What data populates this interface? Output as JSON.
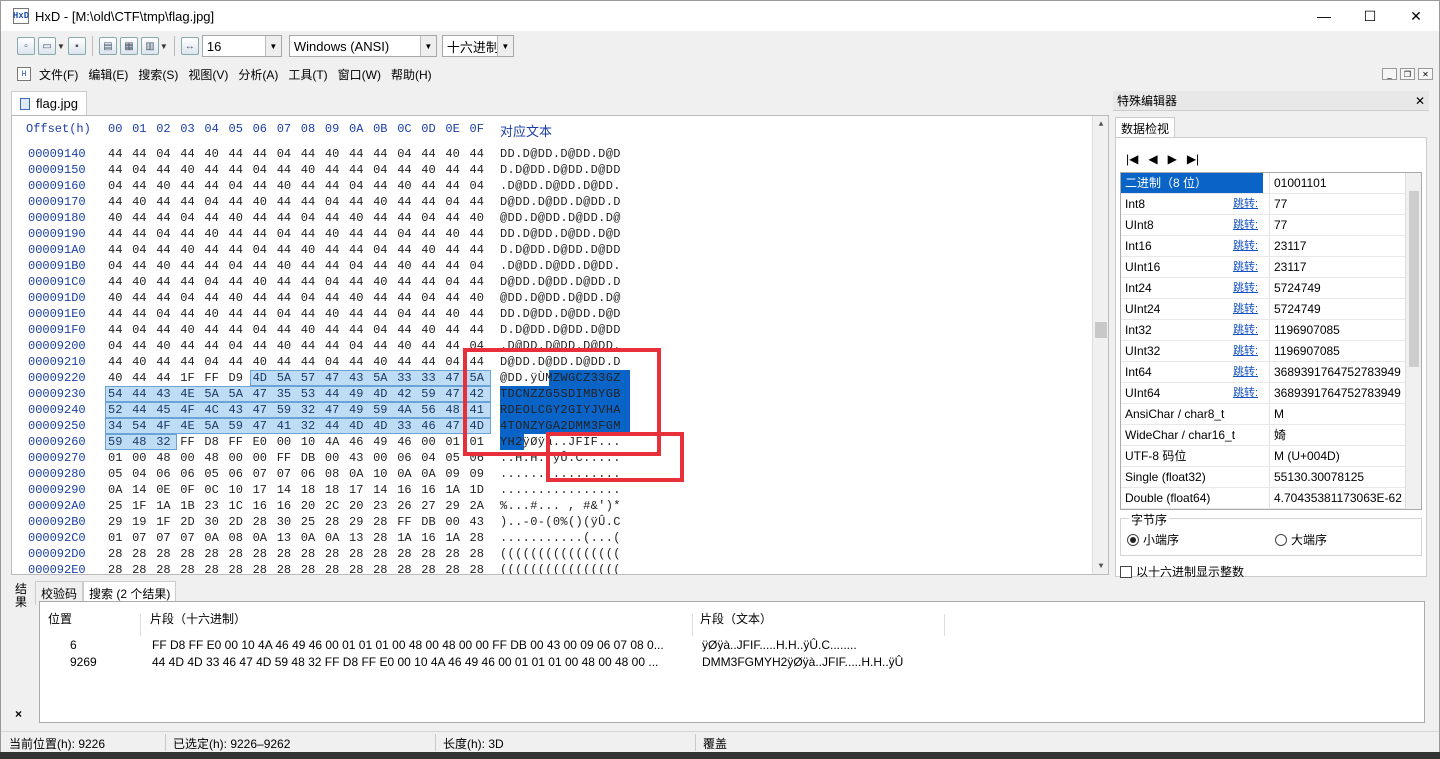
{
  "window": {
    "title": "HxD - [M:\\old\\CTF\\tmp\\flag.jpg]",
    "app_icon": "HxD",
    "minimize": "—",
    "maximize": "☐",
    "close": "✕"
  },
  "toolbar": {
    "bytes_per_row": "16",
    "encoding": "Windows (ANSI)",
    "offset_base": "十六进制"
  },
  "menu": {
    "items": [
      "文件(F)",
      "编辑(E)",
      "搜索(S)",
      "视图(V)",
      "分析(A)",
      "工具(T)",
      "窗口(W)",
      "帮助(H)"
    ]
  },
  "file_tab": "flag.jpg",
  "hex": {
    "offset_header": "Offset(h)",
    "columns": [
      "00",
      "01",
      "02",
      "03",
      "04",
      "05",
      "06",
      "07",
      "08",
      "09",
      "0A",
      "0B",
      "0C",
      "0D",
      "0E",
      "0F"
    ],
    "text_header": "对应文本",
    "rows": [
      {
        "addr": "00009140",
        "bytes": [
          "44",
          "44",
          "04",
          "44",
          "40",
          "44",
          "44",
          "04",
          "44",
          "40",
          "44",
          "44",
          "04",
          "44",
          "40",
          "44"
        ],
        "text": "DD.D@DD.D@DD.D@D"
      },
      {
        "addr": "00009150",
        "bytes": [
          "44",
          "04",
          "44",
          "40",
          "44",
          "44",
          "04",
          "44",
          "40",
          "44",
          "44",
          "04",
          "44",
          "40",
          "44",
          "44"
        ],
        "text": "D.D@DD.D@DD.D@DD"
      },
      {
        "addr": "00009160",
        "bytes": [
          "04",
          "44",
          "40",
          "44",
          "44",
          "04",
          "44",
          "40",
          "44",
          "44",
          "04",
          "44",
          "40",
          "44",
          "44",
          "04"
        ],
        "text": ".D@DD.D@DD.D@DD."
      },
      {
        "addr": "00009170",
        "bytes": [
          "44",
          "40",
          "44",
          "44",
          "04",
          "44",
          "40",
          "44",
          "44",
          "04",
          "44",
          "40",
          "44",
          "44",
          "04",
          "44"
        ],
        "text": "D@DD.D@DD.D@DD.D"
      },
      {
        "addr": "00009180",
        "bytes": [
          "40",
          "44",
          "44",
          "04",
          "44",
          "40",
          "44",
          "44",
          "04",
          "44",
          "40",
          "44",
          "44",
          "04",
          "44",
          "40"
        ],
        "text": "@DD.D@DD.D@DD.D@"
      },
      {
        "addr": "00009190",
        "bytes": [
          "44",
          "44",
          "04",
          "44",
          "40",
          "44",
          "44",
          "04",
          "44",
          "40",
          "44",
          "44",
          "04",
          "44",
          "40",
          "44"
        ],
        "text": "DD.D@DD.D@DD.D@D"
      },
      {
        "addr": "000091A0",
        "bytes": [
          "44",
          "04",
          "44",
          "40",
          "44",
          "44",
          "04",
          "44",
          "40",
          "44",
          "44",
          "04",
          "44",
          "40",
          "44",
          "44"
        ],
        "text": "D.D@DD.D@DD.D@DD"
      },
      {
        "addr": "000091B0",
        "bytes": [
          "04",
          "44",
          "40",
          "44",
          "44",
          "04",
          "44",
          "40",
          "44",
          "44",
          "04",
          "44",
          "40",
          "44",
          "44",
          "04"
        ],
        "text": ".D@DD.D@DD.D@DD."
      },
      {
        "addr": "000091C0",
        "bytes": [
          "44",
          "40",
          "44",
          "44",
          "04",
          "44",
          "40",
          "44",
          "44",
          "04",
          "44",
          "40",
          "44",
          "44",
          "04",
          "44"
        ],
        "text": "D@DD.D@DD.D@DD.D"
      },
      {
        "addr": "000091D0",
        "bytes": [
          "40",
          "44",
          "44",
          "04",
          "44",
          "40",
          "44",
          "44",
          "04",
          "44",
          "40",
          "44",
          "44",
          "04",
          "44",
          "40"
        ],
        "text": "@DD.D@DD.D@DD.D@"
      },
      {
        "addr": "000091E0",
        "bytes": [
          "44",
          "44",
          "04",
          "44",
          "40",
          "44",
          "44",
          "04",
          "44",
          "40",
          "44",
          "44",
          "04",
          "44",
          "40",
          "44"
        ],
        "text": "DD.D@DD.D@DD.D@D"
      },
      {
        "addr": "000091F0",
        "bytes": [
          "44",
          "04",
          "44",
          "40",
          "44",
          "44",
          "04",
          "44",
          "40",
          "44",
          "44",
          "04",
          "44",
          "40",
          "44",
          "44"
        ],
        "text": "D.D@DD.D@DD.D@DD"
      },
      {
        "addr": "00009200",
        "bytes": [
          "04",
          "44",
          "40",
          "44",
          "44",
          "04",
          "44",
          "40",
          "44",
          "44",
          "04",
          "44",
          "40",
          "44",
          "44",
          "04"
        ],
        "text": ".D@DD.D@DD.D@DD."
      },
      {
        "addr": "00009210",
        "bytes": [
          "44",
          "40",
          "44",
          "44",
          "04",
          "44",
          "40",
          "44",
          "44",
          "04",
          "44",
          "40",
          "44",
          "44",
          "04",
          "44"
        ],
        "text": "D@DD.D@DD.D@DD.D"
      },
      {
        "addr": "00009220",
        "bytes": [
          "40",
          "44",
          "44",
          "1F",
          "FF",
          "D9",
          "4D",
          "5A",
          "57",
          "47",
          "43",
          "5A",
          "33",
          "33",
          "47",
          "5A"
        ],
        "text": "@DD.ÿÙMZWGCZ33GZ"
      },
      {
        "addr": "00009230",
        "bytes": [
          "54",
          "44",
          "43",
          "4E",
          "5A",
          "5A",
          "47",
          "35",
          "53",
          "44",
          "49",
          "4D",
          "42",
          "59",
          "47",
          "42"
        ],
        "text": "TDCNZZG5SDIMBYGB"
      },
      {
        "addr": "00009240",
        "bytes": [
          "52",
          "44",
          "45",
          "4F",
          "4C",
          "43",
          "47",
          "59",
          "32",
          "47",
          "49",
          "59",
          "4A",
          "56",
          "48",
          "41"
        ],
        "text": "RDEOLCGY2GIYJVHA"
      },
      {
        "addr": "00009250",
        "bytes": [
          "34",
          "54",
          "4F",
          "4E",
          "5A",
          "59",
          "47",
          "41",
          "32",
          "44",
          "4D",
          "4D",
          "33",
          "46",
          "47",
          "4D"
        ],
        "text": "4TONZYGA2DMM3FGM"
      },
      {
        "addr": "00009260",
        "bytes": [
          "59",
          "48",
          "32",
          "FF",
          "D8",
          "FF",
          "E0",
          "00",
          "10",
          "4A",
          "46",
          "49",
          "46",
          "00",
          "01",
          "01"
        ],
        "text": "YH2ÿØÿà..JFIF..."
      },
      {
        "addr": "00009270",
        "bytes": [
          "01",
          "00",
          "48",
          "00",
          "48",
          "00",
          "00",
          "FF",
          "DB",
          "00",
          "43",
          "00",
          "06",
          "04",
          "05",
          "06"
        ],
        "text": "..H.H..ÿÛ.C....."
      },
      {
        "addr": "00009280",
        "bytes": [
          "05",
          "04",
          "06",
          "06",
          "05",
          "06",
          "07",
          "07",
          "06",
          "08",
          "0A",
          "10",
          "0A",
          "0A",
          "09",
          "09"
        ],
        "text": "................"
      },
      {
        "addr": "00009290",
        "bytes": [
          "0A",
          "14",
          "0E",
          "0F",
          "0C",
          "10",
          "17",
          "14",
          "18",
          "18",
          "17",
          "14",
          "16",
          "16",
          "1A",
          "1D"
        ],
        "text": "................"
      },
      {
        "addr": "000092A0",
        "bytes": [
          "25",
          "1F",
          "1A",
          "1B",
          "23",
          "1C",
          "16",
          "16",
          "20",
          "2C",
          "20",
          "23",
          "26",
          "27",
          "29",
          "2A"
        ],
        "text": "%...#... , #&')*"
      },
      {
        "addr": "000092B0",
        "bytes": [
          "29",
          "19",
          "1F",
          "2D",
          "30",
          "2D",
          "28",
          "30",
          "25",
          "28",
          "29",
          "28",
          "FF",
          "DB",
          "00",
          "43"
        ],
        "text": ")..-0-(0%()(ÿÛ.C"
      },
      {
        "addr": "000092C0",
        "bytes": [
          "01",
          "07",
          "07",
          "07",
          "0A",
          "08",
          "0A",
          "13",
          "0A",
          "0A",
          "13",
          "28",
          "1A",
          "16",
          "1A",
          "28"
        ],
        "text": "...........(...("
      },
      {
        "addr": "000092D0",
        "bytes": [
          "28",
          "28",
          "28",
          "28",
          "28",
          "28",
          "28",
          "28",
          "28",
          "28",
          "28",
          "28",
          "28",
          "28",
          "28",
          "28"
        ],
        "text": "(((((((((((((((("
      },
      {
        "addr": "000092E0",
        "bytes": [
          "28",
          "28",
          "28",
          "28",
          "28",
          "28",
          "28",
          "28",
          "28",
          "28",
          "28",
          "28",
          "28",
          "28",
          "28",
          "28"
        ],
        "text": "(((((((((((((((("
      }
    ]
  },
  "inspector": {
    "panel_title": "特殊编辑器",
    "tab": "数据检视",
    "nav": [
      "|◀",
      "◀",
      "▶",
      "▶|"
    ],
    "rows": [
      {
        "name": "二进制（8 位）",
        "jump": "",
        "value": "01001101"
      },
      {
        "name": "Int8",
        "jump": "跳转:",
        "value": "77"
      },
      {
        "name": "UInt8",
        "jump": "跳转:",
        "value": "77"
      },
      {
        "name": "Int16",
        "jump": "跳转:",
        "value": "23117"
      },
      {
        "name": "UInt16",
        "jump": "跳转:",
        "value": "23117"
      },
      {
        "name": "Int24",
        "jump": "跳转:",
        "value": "5724749"
      },
      {
        "name": "UInt24",
        "jump": "跳转:",
        "value": "5724749"
      },
      {
        "name": "Int32",
        "jump": "跳转:",
        "value": "1196907085"
      },
      {
        "name": "UInt32",
        "jump": "跳转:",
        "value": "1196907085"
      },
      {
        "name": "Int64",
        "jump": "跳转:",
        "value": "3689391764752783949"
      },
      {
        "name": "UInt64",
        "jump": "跳转:",
        "value": "3689391764752783949"
      },
      {
        "name": "AnsiChar / char8_t",
        "jump": "",
        "value": "M"
      },
      {
        "name": "WideChar / char16_t",
        "jump": "",
        "value": "婍"
      },
      {
        "name": "UTF-8 码位",
        "jump": "",
        "value": "M (U+004D)"
      },
      {
        "name": "Single (float32)",
        "jump": "",
        "value": "55130.30078125"
      },
      {
        "name": "Double (float64)",
        "jump": "",
        "value": "4.70435381173063E-62"
      }
    ],
    "byte_order_label": "字节序",
    "little_endian": "小端序",
    "big_endian": "大端序",
    "hex_ints": "以十六进制显示整数"
  },
  "results": {
    "side_label": "结果",
    "close": "×",
    "tabs": [
      "校验码",
      "搜索 (2 个结果)"
    ],
    "headers": {
      "pos": "位置",
      "hex": "片段（十六进制）",
      "text": "片段（文本）"
    },
    "rows": [
      {
        "pos": "6",
        "hex": "FF D8 FF E0 00 10 4A 46 49 46 00 01 01 01 00 48 00 48 00 00 FF DB 00 43 00 09 06 07 08 0...",
        "text": "ÿØÿà..JFIF.....H.H..ÿÛ.C........"
      },
      {
        "pos": "9269",
        "hex": "44 4D 4D 33 46 47 4D 59 48 32 FF D8 FF E0 00 10 4A 46 49 46 00 01 01 01 00 48 00 48 00 ...",
        "text": "DMM3FGMYH2ÿØÿà..JFIF.....H.H..ÿÛ"
      }
    ]
  },
  "status": {
    "position": "当前位置(h):  9226",
    "selection": "已选定(h):  9226–9262",
    "length": "长度(h):  3D",
    "mode": "覆盖"
  },
  "colors": {
    "accent": "#0a64c8",
    "selection_bytes": "#bfdcf5",
    "offset_blue": "#1a3ea8",
    "annotation_red": "#e8303a"
  }
}
